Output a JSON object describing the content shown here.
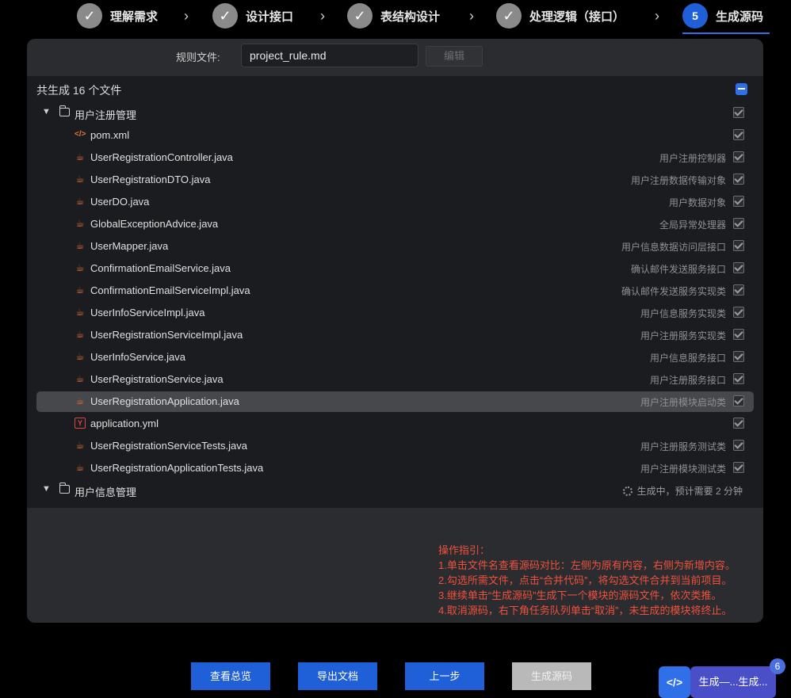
{
  "steps": [
    {
      "label": "理解需求",
      "state": "done"
    },
    {
      "label": "设计接口",
      "state": "done"
    },
    {
      "label": "表结构设计",
      "state": "done"
    },
    {
      "label": "处理逻辑（接口）",
      "state": "done"
    },
    {
      "label": "生成源码",
      "state": "active",
      "number": "5"
    }
  ],
  "rule": {
    "label": "规则文件:",
    "value": "project_rule.md",
    "edit_label": "编辑"
  },
  "summary": "共生成 16 个文件",
  "groups": [
    {
      "name": "用户注册管理",
      "files": [
        {
          "name": "pom.xml",
          "desc": "",
          "icon": "code-icon"
        },
        {
          "name": "UserRegistrationController.java",
          "desc": "用户注册控制器",
          "icon": "java-icon"
        },
        {
          "name": "UserRegistrationDTO.java",
          "desc": "用户注册数据传输对象",
          "icon": "java-icon"
        },
        {
          "name": "UserDO.java",
          "desc": "用户数据对象",
          "icon": "java-icon"
        },
        {
          "name": "GlobalExceptionAdvice.java",
          "desc": "全局异常处理器",
          "icon": "java-icon"
        },
        {
          "name": "UserMapper.java",
          "desc": "用户信息数据访问层接口",
          "icon": "java-icon"
        },
        {
          "name": "ConfirmationEmailService.java",
          "desc": "确认邮件发送服务接口",
          "icon": "java-icon"
        },
        {
          "name": "ConfirmationEmailServiceImpl.java",
          "desc": "确认邮件发送服务实现类",
          "icon": "java-icon"
        },
        {
          "name": "UserInfoServiceImpl.java",
          "desc": "用户信息服务实现类",
          "icon": "java-icon"
        },
        {
          "name": "UserRegistrationServiceImpl.java",
          "desc": "用户注册服务实现类",
          "icon": "java-icon"
        },
        {
          "name": "UserInfoService.java",
          "desc": "用户信息服务接口",
          "icon": "java-icon"
        },
        {
          "name": "UserRegistrationService.java",
          "desc": "用户注册服务接口",
          "icon": "java-icon"
        },
        {
          "name": "UserRegistrationApplication.java",
          "desc": "用户注册模块启动类",
          "icon": "java-icon"
        },
        {
          "name": "application.yml",
          "desc": "",
          "icon": "yml-icon"
        },
        {
          "name": "UserRegistrationServiceTests.java",
          "desc": "用户注册服务测试类",
          "icon": "java-icon"
        },
        {
          "name": "UserRegistrationApplicationTests.java",
          "desc": "用户注册模块测试类",
          "icon": "java-icon"
        }
      ]
    },
    {
      "name": "用户信息管理",
      "status": "生成中，预计需要 2 分钟"
    }
  ],
  "guide": [
    "操作指引：",
    "1.单击文件名查看源码对比：左侧为原有内容，右侧为新增内容。",
    "2.勾选所需文件，点击“合并代码”，将勾选文件合并到当前项目。",
    "3.继续单击“生成源码”生成下一个模块的源码文件，依次类推。",
    "4.取消源码，右下角任务队列单击“取消”，未生成的模块将终止。"
  ],
  "buttons": {
    "overview": "查看总览",
    "export": "导出文档",
    "prev": "上一步",
    "generate": "生成源码"
  },
  "task_queue": {
    "label": "生成—...生成...",
    "count": "6"
  }
}
